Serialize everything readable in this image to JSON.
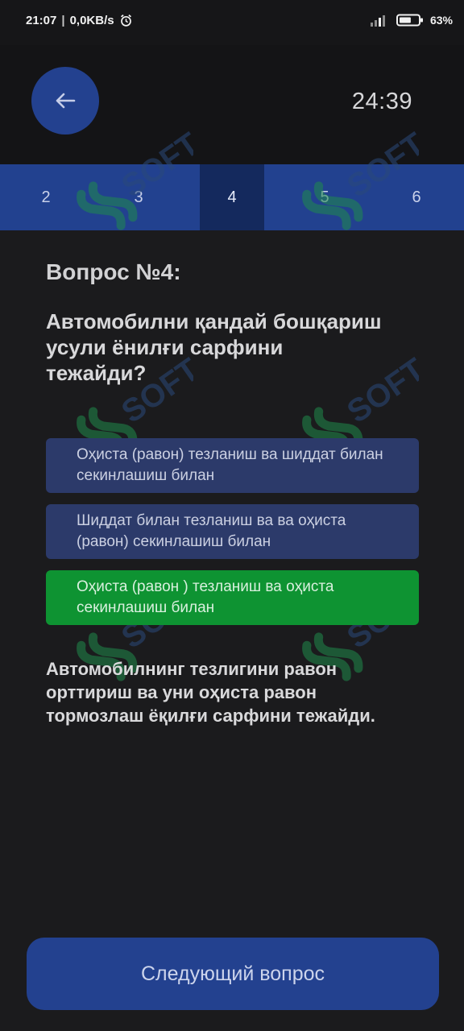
{
  "status_bar": {
    "time": "21:07",
    "network_speed": "0,0KB/s",
    "alarm_icon": "alarm-clock-icon",
    "signal_icon": "cell-signal-icon",
    "battery_icon": "battery-icon",
    "battery_percent": "63%",
    "battery_level": 0.63
  },
  "header": {
    "back_icon": "arrow-left-icon",
    "timer": "24:39"
  },
  "question_tabs": [
    {
      "label": "2",
      "active": false
    },
    {
      "label": "3",
      "active": false
    },
    {
      "label": "4",
      "active": true
    },
    {
      "label": "5",
      "active": false
    },
    {
      "label": "6",
      "active": false
    }
  ],
  "question": {
    "number_label": "Вопрос №4:",
    "text": "Автомобилни қандай бошқариш усули ёнилғи сарфини тежайди?"
  },
  "answers": [
    {
      "text": "Оҳиста (равон) тезланиш ва шиддат билан секинлашиш билан",
      "state": "default"
    },
    {
      "text": "Шиддат билан тезланиш ва ва оҳиста (равон) секинлашиш билан",
      "state": "default"
    },
    {
      "text": "Оҳиста (равон ) тезланиш ва оҳиста секинлашиш билан",
      "state": "correct"
    }
  ],
  "explanation": "Автомобилнинг тезлигини равон орттириш ва уни оҳиста равон тормозлаш ёқилғи сарфини тежайди.",
  "next_button": {
    "label": "Следующий вопрос"
  },
  "watermark": {
    "text": "SOFT",
    "icon": "brand-logo-icon"
  },
  "colors": {
    "background": "#1b1b1d",
    "primary_blue": "#23418f",
    "answer_default": "#2c3a6a",
    "answer_correct": "#0e9332",
    "watermark_green": "#1f8a4c"
  }
}
